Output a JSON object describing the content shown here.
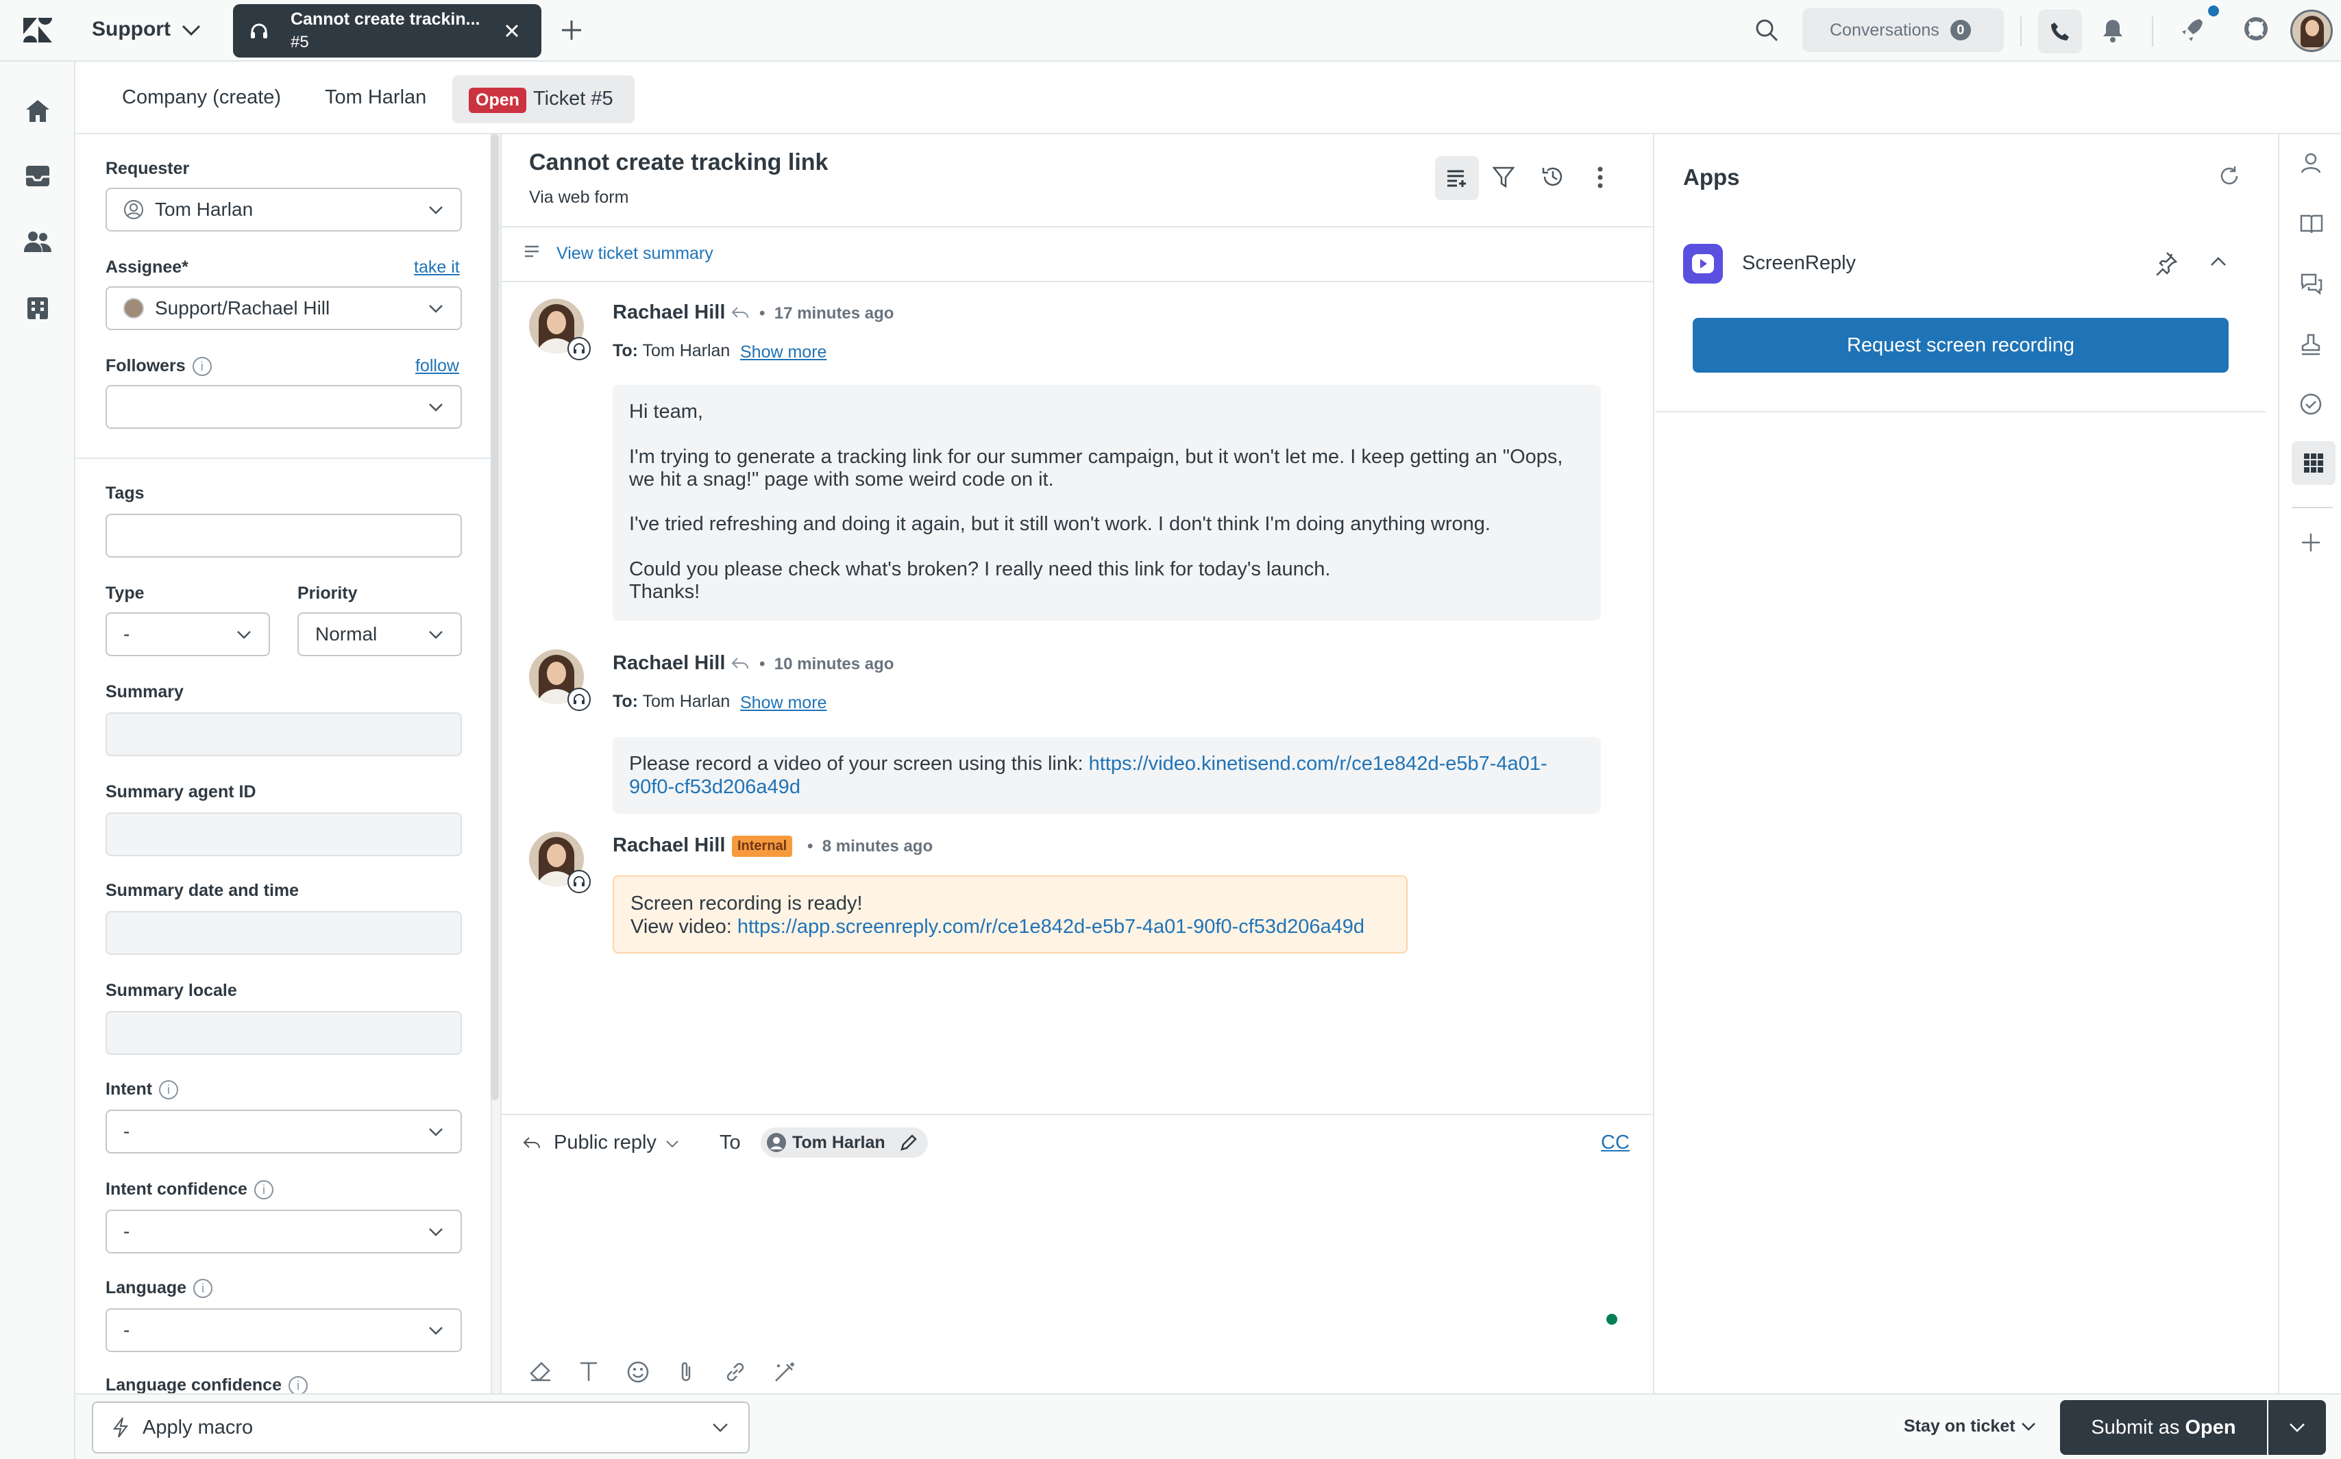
{
  "topbar": {
    "product": "Support",
    "active_tab": {
      "title": "Cannot create trackin...",
      "subtitle": "#5"
    },
    "conversations_label": "Conversations",
    "conversations_count": "0"
  },
  "tabs": {
    "company": "Company (create)",
    "user": "Tom Harlan",
    "ticket_status": "Open",
    "ticket": "Ticket #5"
  },
  "properties": {
    "requester_label": "Requester",
    "requester_value": "Tom Harlan",
    "assignee_label": "Assignee*",
    "take_it": "take it",
    "assignee_value": "Support/Rachael Hill",
    "followers_label": "Followers",
    "follow": "follow",
    "tags_label": "Tags",
    "type_label": "Type",
    "type_value": "-",
    "priority_label": "Priority",
    "priority_value": "Normal",
    "summary_label": "Summary",
    "summary_agent_label": "Summary agent ID",
    "summary_date_label": "Summary date and time",
    "summary_locale_label": "Summary locale",
    "intent_label": "Intent",
    "intent_value": "-",
    "intent_conf_label": "Intent confidence",
    "intent_conf_value": "-",
    "language_label": "Language",
    "language_value": "-",
    "language_conf_label": "Language confidence"
  },
  "ticket": {
    "title": "Cannot create tracking link",
    "via": "Via web form",
    "summary_link": "View ticket summary"
  },
  "messages": [
    {
      "author": "Rachael Hill",
      "time": "17 minutes ago",
      "to_label": "To:",
      "to": "Tom Harlan",
      "show_more": "Show more",
      "lines": [
        "Hi team,",
        "I'm trying to generate a tracking link for our summer campaign, but it won't let me. I keep getting an \"Oops,",
        "we hit a snag!\" page with some weird code on it.",
        "I've tried refreshing and doing it again, but it still won't work. I don't think I'm doing anything wrong.",
        "Could you please check what's broken? I really need this link for today's launch.",
        "Thanks!"
      ]
    },
    {
      "author": "Rachael Hill",
      "time": "10 minutes ago",
      "to_label": "To:",
      "to": "Tom Harlan",
      "show_more": "Show more",
      "text": "Please record a video of your screen using this link: ",
      "link_part1": "https://video.kinetisend.com/r/ce1e842d-e5b7-4a01-",
      "link_part2": "90f0-cf53d206a49d"
    },
    {
      "author": "Rachael Hill",
      "badge": "Internal",
      "time": "8 minutes ago",
      "line1": "Screen recording is ready!",
      "line2_prefix": "View video: ",
      "link": "https://app.screenreply.com/r/ce1e842d-e5b7-4a01-90f0-cf53d206a49d"
    }
  ],
  "composer": {
    "mode": "Public reply",
    "to_label": "To",
    "recipient": "Tom Harlan",
    "cc": "CC"
  },
  "apps": {
    "title": "Apps",
    "app_name": "ScreenReply",
    "button": "Request screen recording"
  },
  "footer": {
    "macro": "Apply macro",
    "stay": "Stay on ticket",
    "submit_prefix": "Submit as ",
    "submit_status": "Open"
  },
  "colors": {
    "brand_blue": "#1f73b7",
    "open_red": "#cc3340",
    "internal_orange": "#f79a3e",
    "internal_bg": "#fff3e4",
    "dark_button": "#2f3941"
  }
}
